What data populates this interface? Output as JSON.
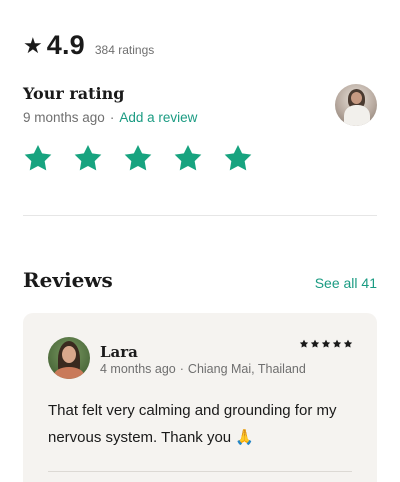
{
  "summary": {
    "star_icon": "star-icon",
    "score": "4.9",
    "count": "384 ratings"
  },
  "your_rating": {
    "title": "Your rating",
    "time_ago": "9 months ago",
    "separator": "·",
    "add_review": "Add a review",
    "stars": 5,
    "star_color": "#17a37f",
    "avatar_icon": "user-avatar"
  },
  "reviews": {
    "title": "Reviews",
    "see_all": "See all 41",
    "accent_color": "#1a9b82",
    "items": [
      {
        "name": "Lara",
        "time_ago": "4 months ago",
        "separator": "·",
        "location": "Chiang Mai, Thailand",
        "rating": 5,
        "text": "That felt very calming and grounding for my nervous system. Thank you 🙏"
      }
    ]
  }
}
